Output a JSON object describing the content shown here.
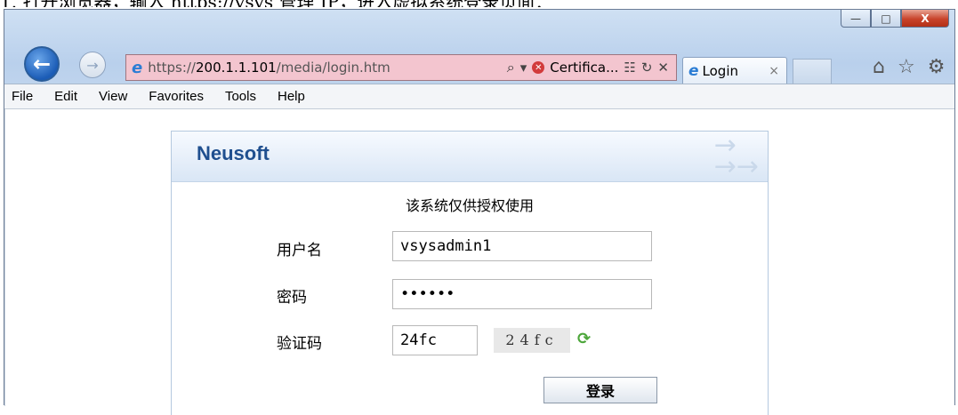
{
  "document": {
    "instruction": "1.  打开浏览器，输入 https://vsys 管理 IP，进入虚拟系统登录页面："
  },
  "window_controls": {
    "minimize": "—",
    "maximize": "□",
    "close": "X"
  },
  "address_bar": {
    "url_prefix": "https://",
    "url_host": "200.1.1.101",
    "url_path": "/media/login.htm",
    "certificate_text": "Certifica...",
    "search_icon": "search-icon",
    "dropdown": "▾",
    "cert_error_icon": "cert-error-icon",
    "compat_icon": "compat-view-icon",
    "refresh_icon": "refresh-icon",
    "stop_icon": "stop-icon"
  },
  "tab": {
    "title": "Login",
    "close": "×"
  },
  "toolbar_icons": [
    "home-icon",
    "favorites-star-icon",
    "settings-gear-icon"
  ],
  "menu": [
    "File",
    "Edit",
    "View",
    "Favorites",
    "Tools",
    "Help"
  ],
  "login": {
    "brand": "Neusoft",
    "notice": "该系统仅供授权使用",
    "username_label": "用户名",
    "username_value": "vsysadmin1",
    "password_label": "密码",
    "password_value": "••••••",
    "captcha_label": "验证码",
    "captcha_value": "24fc",
    "captcha_image_text": "24fc",
    "submit": "登录"
  },
  "colors": {
    "address_bg": "#f3c5cf",
    "brand": "#1f4f8f",
    "back_button": "#1b5cb6"
  }
}
